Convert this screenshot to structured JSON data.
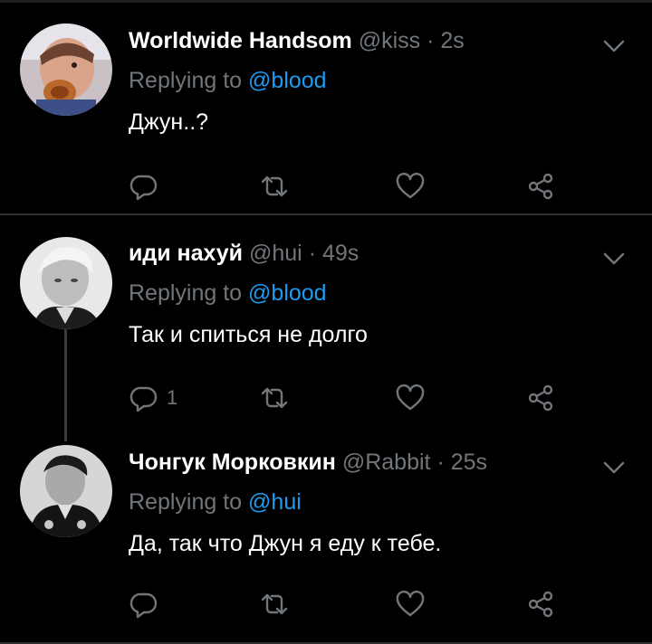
{
  "tweets": [
    {
      "display_name": "Worldwide Handsom",
      "handle": "@kiss",
      "separator": "·",
      "time": "2s",
      "reply_prefix": "Replying to",
      "reply_to": "@blood",
      "text": "Джун..?",
      "reply_count": "",
      "avatar": "avatar-photo"
    },
    {
      "display_name": "иди нахуй",
      "handle": "@hui",
      "separator": "·",
      "time": "49s",
      "reply_prefix": "Replying to",
      "reply_to": "@blood",
      "text": "Так и спиться не долго",
      "reply_count": "1",
      "avatar": "avatar-photo"
    },
    {
      "display_name": "Чонгук Морковкин",
      "handle": "@Rabbit",
      "separator": "·",
      "time": "25s",
      "reply_prefix": "Replying to",
      "reply_to": "@hui",
      "text": "Да, так что Джун я еду к тебе.",
      "reply_count": "",
      "avatar": "avatar-photo"
    }
  ],
  "icons": {
    "reply": "reply-icon",
    "retweet": "retweet-icon",
    "like": "heart-icon",
    "share": "share-icon",
    "more": "chevron-down-icon"
  },
  "colors": {
    "background": "#000000",
    "text": "#ffffff",
    "secondary": "#71767b",
    "accent": "#1d9bf0",
    "divider": "#2a2d31"
  }
}
